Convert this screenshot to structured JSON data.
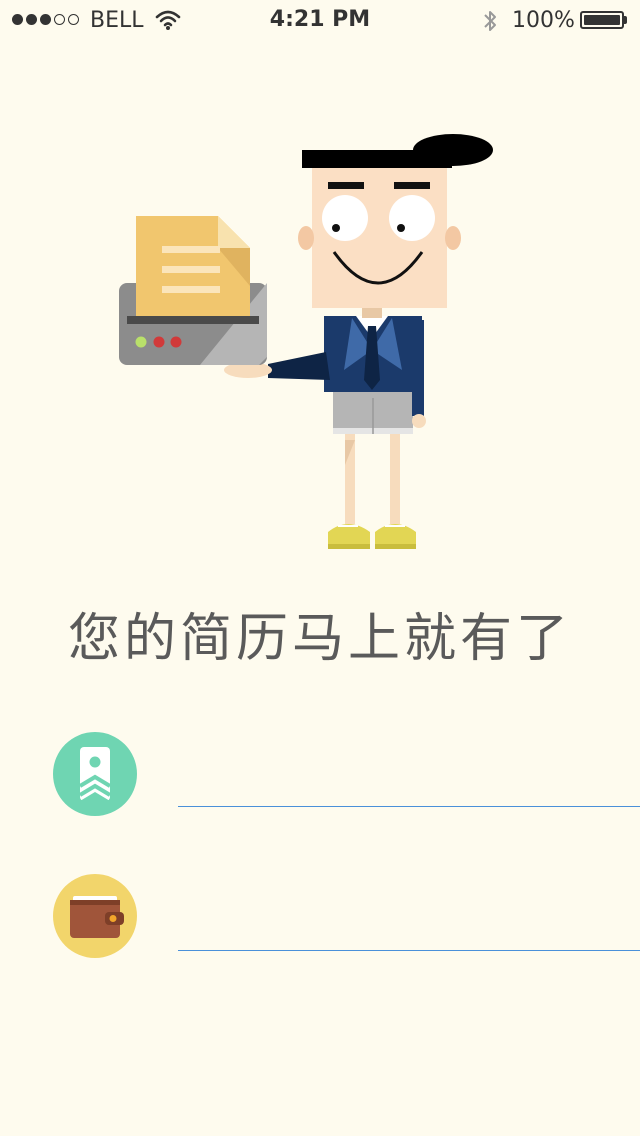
{
  "status_bar": {
    "carrier": "BELL",
    "time": "4:21 PM",
    "battery": "100%",
    "signal_bars_full": 3,
    "signal_bars_total": 5
  },
  "headline": "您的简历马上就有了",
  "options": [
    {
      "icon": "resume-badge-icon",
      "icon_bg": "#6fd5b2"
    },
    {
      "icon": "wallet-icon",
      "icon_bg": "#f2d56b"
    }
  ],
  "colors": {
    "background": "#fefbee",
    "field_line": "#4a90d9",
    "suit": "#1b3a6b",
    "shoes": "#e2d654"
  }
}
